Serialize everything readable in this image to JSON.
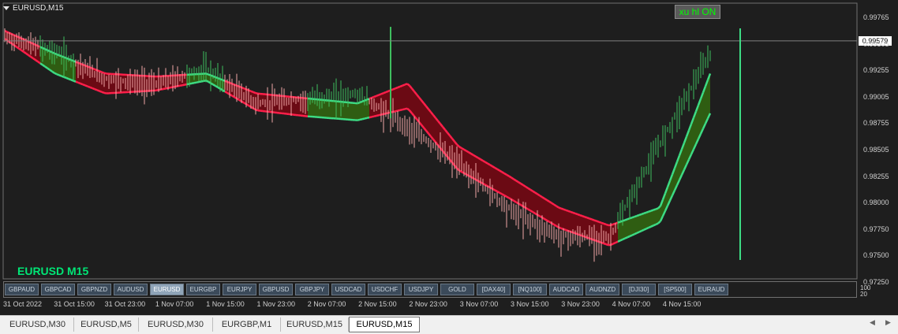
{
  "window": {
    "symbol_title": "EURUSD,M15",
    "indicator_button": "xu hl ON",
    "big_label": "EURUSD M15",
    "current_price": "0.99579"
  },
  "colors": {
    "background": "#1e1e1e",
    "bull_candle": "#3fbf5f",
    "bear_candle": "#f0a6a6",
    "red_band_line": "#ff1f4a",
    "red_band_fill": "#6b0a14",
    "green_band_line": "#3ddc84",
    "green_band_fill": "#2f5d12"
  },
  "y_axis_labels": [
    "0.99765",
    "0.99505",
    "0.99255",
    "0.99005",
    "0.98755",
    "0.98505",
    "0.98255",
    "0.98000",
    "0.97750",
    "0.97500",
    "0.97250"
  ],
  "sub_axis_labels": [
    "100",
    "20"
  ],
  "symbol_buttons": [
    {
      "label": "GBPAUD",
      "active": false
    },
    {
      "label": "GBPCAD",
      "active": false
    },
    {
      "label": "GBPNZD",
      "active": false
    },
    {
      "label": "AUDUSD",
      "active": false
    },
    {
      "label": "EURUSD",
      "active": true
    },
    {
      "label": "EURGBP",
      "active": false
    },
    {
      "label": "EURJPY",
      "active": false
    },
    {
      "label": "GBPUSD",
      "active": false
    },
    {
      "label": "GBPJPY",
      "active": false
    },
    {
      "label": "USDCAD",
      "active": false
    },
    {
      "label": "USDCHF",
      "active": false
    },
    {
      "label": "USDJPY",
      "active": false
    },
    {
      "label": "GOLD",
      "active": false
    },
    {
      "label": "[DAX40]",
      "active": false
    },
    {
      "label": "[NQ100]",
      "active": false
    },
    {
      "label": "AUDCAD",
      "active": false
    },
    {
      "label": "AUDNZD",
      "active": false
    },
    {
      "label": "[DJI30]",
      "active": false
    },
    {
      "label": "[SP500]",
      "active": false
    },
    {
      "label": "EURAUD",
      "active": false
    }
  ],
  "x_axis_labels": [
    "31 Oct 2022",
    "31 Oct 15:00",
    "31 Oct 23:00",
    "1 Nov 07:00",
    "1 Nov 15:00",
    "1 Nov 23:00",
    "2 Nov 07:00",
    "2 Nov 15:00",
    "2 Nov 23:00",
    "3 Nov 07:00",
    "3 Nov 15:00",
    "3 Nov 23:00",
    "4 Nov 07:00",
    "4 Nov 15:00"
  ],
  "tabs": [
    {
      "label": "EURUSD,M30",
      "active": false
    },
    {
      "label": "EURUSD,M5",
      "active": false
    },
    {
      "label": "EURUSD,M30",
      "active": false
    },
    {
      "label": "EURGBP,M1",
      "active": false
    },
    {
      "label": "EURUSD,M15",
      "active": false
    },
    {
      "label": "EURUSD,M15",
      "active": true
    }
  ],
  "chart_data": {
    "type": "line",
    "title": "EURUSD,M15",
    "y_range": [
      0.972,
      0.998
    ],
    "x_categories": [
      "31 Oct 2022",
      "31 Oct 15:00",
      "31 Oct 23:00",
      "1 Nov 07:00",
      "1 Nov 15:00",
      "1 Nov 23:00",
      "2 Nov 07:00",
      "2 Nov 15:00",
      "2 Nov 23:00",
      "3 Nov 07:00",
      "3 Nov 15:00",
      "3 Nov 23:00",
      "4 Nov 07:00",
      "4 Nov 15:00"
    ],
    "series": [
      {
        "values": [
          0.9962,
          0.9948,
          0.992,
          0.9915,
          0.993,
          0.9895,
          0.99,
          0.9905,
          0.9872,
          0.9835,
          0.979,
          0.9762,
          0.976,
          0.9855,
          0.9945
        ]
      },
      {
        "values": [
          0.9968,
          0.9945,
          0.9925,
          0.9922,
          0.9925,
          0.9905,
          0.99,
          0.9895,
          0.9915,
          0.9852,
          0.9822,
          0.979,
          0.9772,
          0.979,
          0.9925
        ]
      },
      {
        "values": [
          0.996,
          0.9925,
          0.9905,
          0.9908,
          0.9918,
          0.9888,
          0.9882,
          0.9878,
          0.989,
          0.9828,
          0.98,
          0.977,
          0.9752,
          0.9775,
          0.9885
        ]
      }
    ],
    "current_price": 0.99579,
    "grid": false,
    "legend": "none"
  }
}
